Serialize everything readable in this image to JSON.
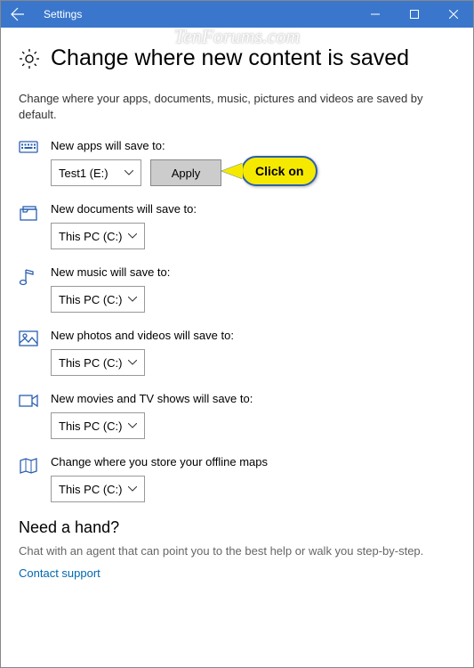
{
  "watermark": "TenForums.com",
  "titlebar": {
    "title": "Settings"
  },
  "page": {
    "heading": "Change where new content is saved",
    "description": "Change where your apps, documents, music, pictures and videos are saved by default."
  },
  "settings": {
    "apps": {
      "label": "New apps will save to:",
      "value": "Test1 (E:)",
      "apply": "Apply"
    },
    "docs": {
      "label": "New documents will save to:",
      "value": "This PC (C:)"
    },
    "music": {
      "label": "New music will save to:",
      "value": "This PC (C:)"
    },
    "photos": {
      "label": "New photos and videos will save to:",
      "value": "This PC (C:)"
    },
    "movies": {
      "label": "New movies and TV shows will save to:",
      "value": "This PC (C:)"
    },
    "maps": {
      "label": "Change where you store your offline maps",
      "value": "This PC (C:)"
    }
  },
  "callout": {
    "text": "Click on"
  },
  "help": {
    "heading": "Need a hand?",
    "text": "Chat with an agent that can point you to the best help or walk you step-by-step.",
    "link": "Contact support"
  }
}
